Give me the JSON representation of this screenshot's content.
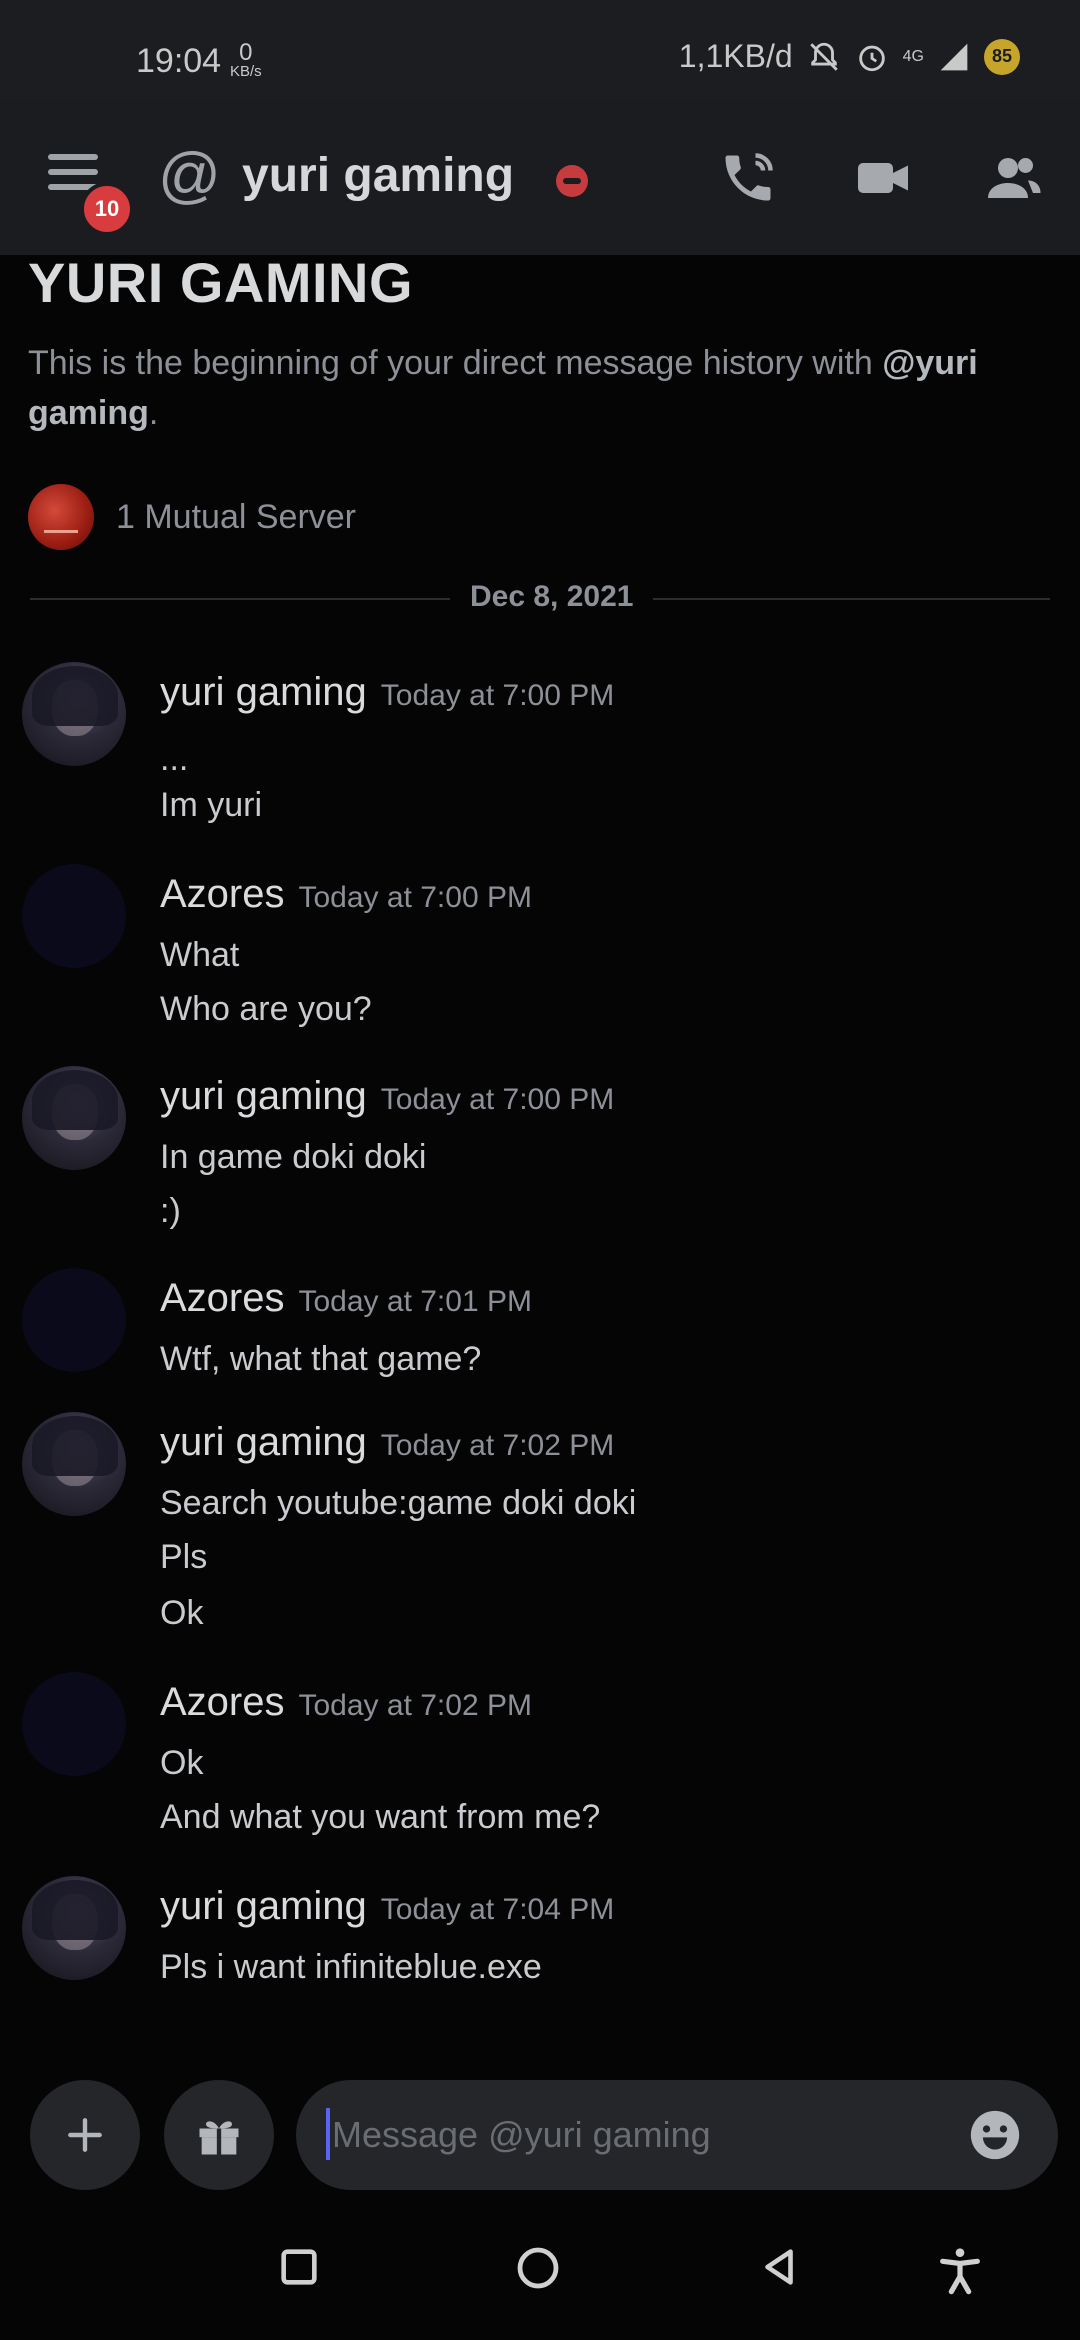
{
  "status_bar": {
    "time": "19:04",
    "net_speed_value": "0",
    "net_speed_unit": "KB/s",
    "data_usage": "1,1KB/d",
    "network": "4G",
    "battery": "85"
  },
  "header": {
    "unread_badge": "10",
    "at_symbol": "@",
    "title": "yuri gaming",
    "status": "do-not-disturb"
  },
  "intro": {
    "title": "YURI GAMING",
    "desc_prefix": "This is the beginning of your direct message history with ",
    "desc_user": "@yuri gaming",
    "desc_suffix": ".",
    "mutual_servers": "1 Mutual Server"
  },
  "divider": {
    "date": "Dec 8, 2021"
  },
  "messages": [
    {
      "author": "yuri gaming",
      "time": "Today at 7:00 PM",
      "lines": [
        "...",
        "Im yuri"
      ]
    },
    {
      "author": "Azores",
      "time": "Today at 7:00 PM",
      "lines": [
        "What",
        "Who are you?"
      ]
    },
    {
      "author": "yuri gaming",
      "time": "Today at 7:00 PM",
      "lines": [
        "In game doki doki",
        ":)"
      ]
    },
    {
      "author": "Azores",
      "time": "Today at 7:01 PM",
      "lines": [
        "Wtf, what that game?"
      ]
    },
    {
      "author": "yuri gaming",
      "time": "Today at 7:02 PM",
      "lines": [
        "Search youtube:game doki doki",
        "Pls",
        "Ok"
      ]
    },
    {
      "author": "Azores",
      "time": "Today at 7:02 PM",
      "lines": [
        "Ok",
        "And what you want from me?"
      ]
    },
    {
      "author": "yuri gaming",
      "time": "Today at 7:04 PM",
      "lines": [
        "Pls i want infiniteblue.exe"
      ]
    }
  ],
  "composer": {
    "placeholder": "Message @yuri gaming"
  },
  "colors": {
    "background": "#050506",
    "header": "#1b1c1f",
    "badge": "#d83c3e",
    "accent": "#5865f2"
  }
}
